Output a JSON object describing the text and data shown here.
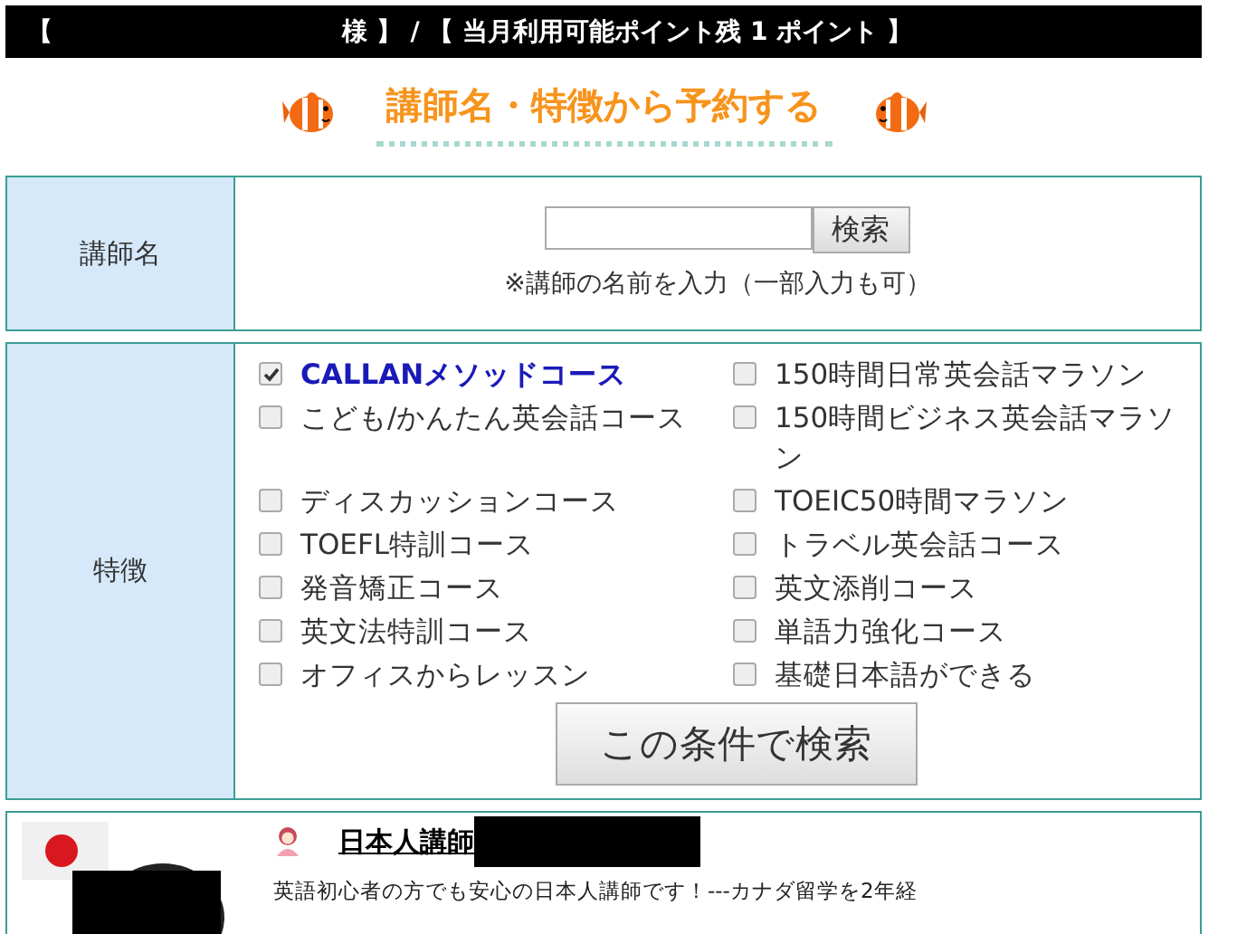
{
  "header": {
    "open_bracket": "【",
    "account_text": "様 】 / 【 当月利用可能ポイント残 1 ポイント 】"
  },
  "title": "講師名・特徴から予約する",
  "name_search": {
    "label": "講師名",
    "button": "検索",
    "hint": "※講師の名前を入力（一部入力も可）"
  },
  "features": {
    "label": "特徴",
    "button": "この条件で検索",
    "options": [
      {
        "label": "CALLANメソッドコース",
        "checked": true
      },
      {
        "label": "150時間日常英会話マラソン",
        "checked": false
      },
      {
        "label": "こども/かんたん英会話コース",
        "checked": false
      },
      {
        "label": "150時間ビジネス英会話マラソン",
        "checked": false
      },
      {
        "label": "ディスカッションコース",
        "checked": false
      },
      {
        "label": "TOEIC50時間マラソン",
        "checked": false
      },
      {
        "label": "TOEFL特訓コース",
        "checked": false
      },
      {
        "label": "トラベル英会話コース",
        "checked": false
      },
      {
        "label": "発音矯正コース",
        "checked": false
      },
      {
        "label": "英文添削コース",
        "checked": false
      },
      {
        "label": "英文法特訓コース",
        "checked": false
      },
      {
        "label": "単語力強化コース",
        "checked": false
      },
      {
        "label": "オフィスからレッスン",
        "checked": false
      },
      {
        "label": "基礎日本語ができる",
        "checked": false
      }
    ]
  },
  "teacher": {
    "name": "日本人講師",
    "description": "英語初心者の方でも安心の日本人講師です！---カナダ留学を2年経"
  }
}
